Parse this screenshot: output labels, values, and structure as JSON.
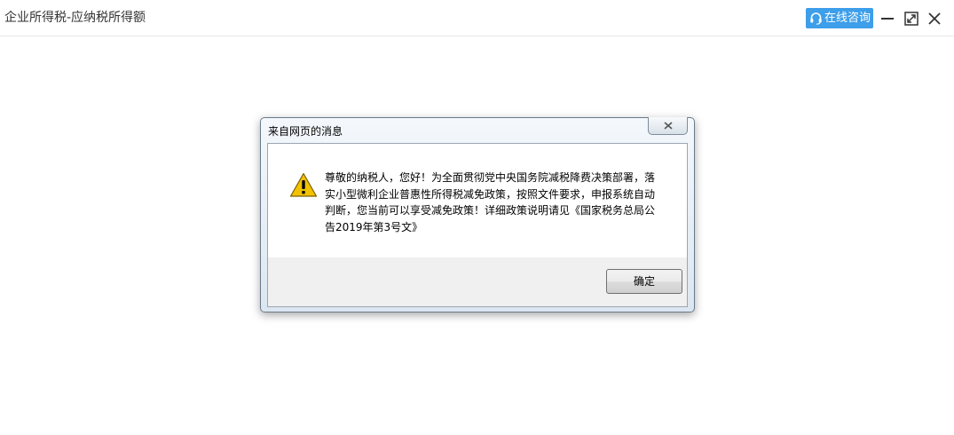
{
  "window": {
    "title": "企业所得税-应纳税所得额",
    "consult_label": "在线咨询"
  },
  "dialog": {
    "title": "来自网页的消息",
    "message_lines": [
      "尊敬的纳税人，您好！为全面贯彻党中央国务院减税降费决策部署，落",
      "实小型微利企业普惠性所得税减免政策，按照文件要求，申报系统自动",
      "判断，您当前可以享受减免政策！详细政策说明请见《国家税务总局公",
      "告2019年第3号文》"
    ],
    "ok_label": "确定",
    "icon": "warning-icon"
  },
  "colors": {
    "accent": "#3d9eea",
    "warning": "#f2c200"
  }
}
